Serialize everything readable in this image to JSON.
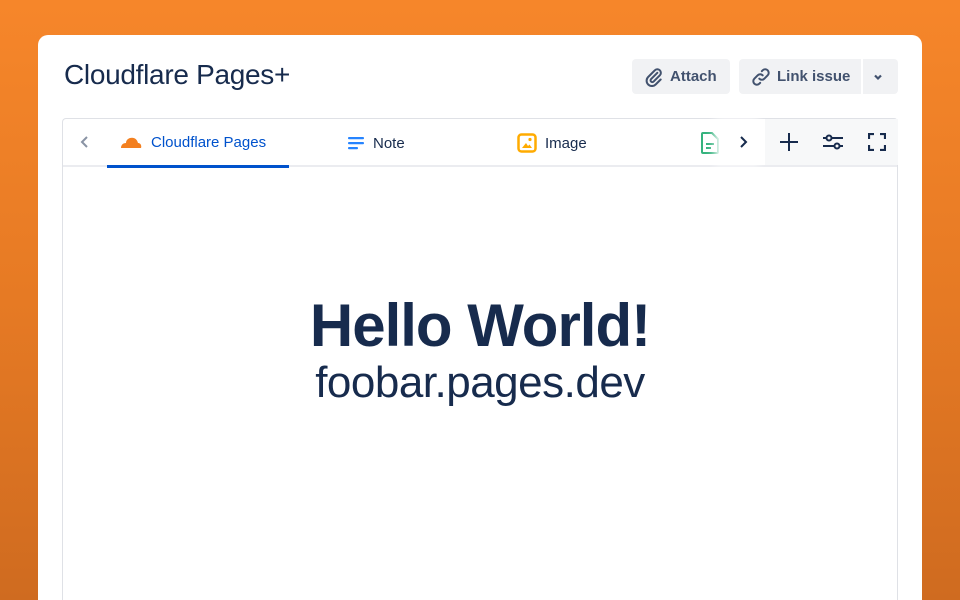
{
  "header": {
    "title": "Cloudflare Pages+",
    "attach_label": "Attach",
    "link_issue_label": "Link issue"
  },
  "tabs": [
    {
      "label": "Cloudflare Pages",
      "icon": "cloudflare-icon",
      "active": true
    },
    {
      "label": "Note",
      "icon": "note-icon"
    },
    {
      "label": "Image",
      "icon": "image-icon"
    },
    {
      "label": "",
      "icon": "document-icon"
    }
  ],
  "content": {
    "heading": "Hello World!",
    "subheading": "foobar.pages.dev"
  },
  "colors": {
    "accent": "#0052cc",
    "text": "#172b4d",
    "cloudflare": "#f38020",
    "image": "#ffab00",
    "doc": "#36b37e"
  }
}
